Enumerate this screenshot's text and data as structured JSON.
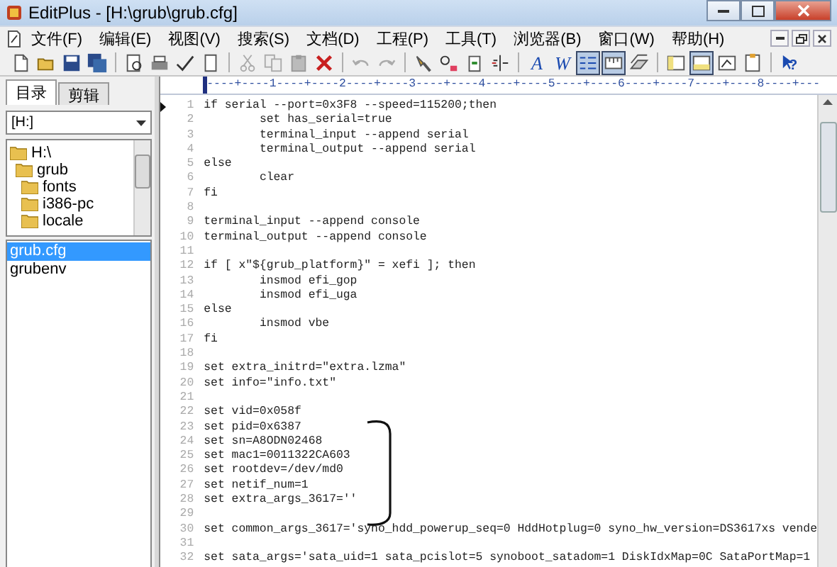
{
  "window": {
    "title": "EditPlus - [H:\\grub\\grub.cfg]"
  },
  "menu": [
    "文件(F)",
    "编辑(E)",
    "视图(V)",
    "搜索(S)",
    "文档(D)",
    "工程(P)",
    "工具(T)",
    "浏览器(B)",
    "窗口(W)",
    "帮助(H)"
  ],
  "toolbar": [
    {
      "kind": "new",
      "pressed": false
    },
    {
      "kind": "open",
      "pressed": false
    },
    {
      "kind": "save",
      "pressed": false
    },
    {
      "kind": "save-all",
      "pressed": false
    },
    {
      "kind": "separator"
    },
    {
      "kind": "preview",
      "pressed": false
    },
    {
      "kind": "print",
      "pressed": false
    },
    {
      "kind": "spell",
      "pressed": false
    },
    {
      "kind": "doc",
      "pressed": false
    },
    {
      "kind": "separator"
    },
    {
      "kind": "cut",
      "pressed": false
    },
    {
      "kind": "copy",
      "pressed": false
    },
    {
      "kind": "paste",
      "pressed": false
    },
    {
      "kind": "delete",
      "pressed": false
    },
    {
      "kind": "separator"
    },
    {
      "kind": "undo",
      "pressed": false
    },
    {
      "kind": "redo",
      "pressed": false
    },
    {
      "kind": "separator"
    },
    {
      "kind": "find",
      "pressed": false
    },
    {
      "kind": "replace",
      "pressed": false
    },
    {
      "kind": "goto",
      "pressed": false
    },
    {
      "kind": "column",
      "pressed": false
    },
    {
      "kind": "separator"
    },
    {
      "kind": "font",
      "glyph": "A",
      "pressed": false
    },
    {
      "kind": "wrap",
      "glyph": "W",
      "pressed": false
    },
    {
      "kind": "linenum",
      "pressed": true
    },
    {
      "kind": "ruler",
      "pressed": true
    },
    {
      "kind": "layers",
      "pressed": false
    },
    {
      "kind": "separator"
    },
    {
      "kind": "panel",
      "pressed": false
    },
    {
      "kind": "output",
      "pressed": true
    },
    {
      "kind": "browser",
      "pressed": false
    },
    {
      "kind": "clip",
      "pressed": false
    },
    {
      "kind": "separator"
    },
    {
      "kind": "help",
      "glyph": "?",
      "pressed": false
    }
  ],
  "sidebar": {
    "tabs": [
      {
        "label": "目录",
        "selected": true
      },
      {
        "label": "剪辑",
        "selected": false
      }
    ],
    "drive": "[H:]",
    "tree": [
      {
        "label": "H:\\",
        "children": [
          {
            "label": "grub",
            "children": [
              {
                "label": "fonts"
              },
              {
                "label": "i386-pc"
              },
              {
                "label": "locale"
              }
            ]
          }
        ]
      }
    ],
    "files": [
      {
        "label": "grub.cfg",
        "selected": true
      },
      {
        "label": "grubenv",
        "selected": false
      }
    ]
  },
  "editor": {
    "ruler": "----+----1----+----2----+----3----+----4----+----5----+----6----+----7----+----8----+---",
    "lines": [
      {
        "number": "1",
        "current": true,
        "text": "if serial --port=0x3F8 --speed=115200;then"
      },
      {
        "number": "2",
        "current": false,
        "text": "\tset has_serial=true"
      },
      {
        "number": "3",
        "current": false,
        "text": "\tterminal_input --append serial"
      },
      {
        "number": "4",
        "current": false,
        "text": "\tterminal_output --append serial"
      },
      {
        "number": "5",
        "current": false,
        "text": "else"
      },
      {
        "number": "6",
        "current": false,
        "text": "\tclear"
      },
      {
        "number": "7",
        "current": false,
        "text": "fi"
      },
      {
        "number": "8",
        "current": false
      },
      {
        "number": "9",
        "current": false,
        "text": "terminal_input --append console"
      },
      {
        "number": "10",
        "current": false,
        "text": "terminal_output --append console"
      },
      {
        "number": "11",
        "current": false
      },
      {
        "number": "12",
        "current": false,
        "text": "if [ x\"${grub_platform}\" = xefi ]; then"
      },
      {
        "number": "13",
        "current": false,
        "text": "\tinsmod efi_gop"
      },
      {
        "number": "14",
        "current": false,
        "text": "\tinsmod efi_uga"
      },
      {
        "number": "15",
        "current": false,
        "text": "else"
      },
      {
        "number": "16",
        "current": false,
        "text": "\tinsmod vbe"
      },
      {
        "number": "17",
        "current": false,
        "text": "fi"
      },
      {
        "number": "18",
        "current": false
      },
      {
        "number": "19",
        "current": false,
        "text": "set extra_initrd=\"extra.lzma\""
      },
      {
        "number": "20",
        "current": false,
        "text": "set info=\"info.txt\""
      },
      {
        "number": "21",
        "current": false
      },
      {
        "number": "22",
        "current": false,
        "text": "set vid=0x058f"
      },
      {
        "number": "23",
        "current": false,
        "text": "set pid=0x6387"
      },
      {
        "number": "24",
        "current": false,
        "text": "set sn=A8ODN02468"
      },
      {
        "number": "25",
        "current": false,
        "text": "set mac1=0011322CA603"
      },
      {
        "number": "26",
        "current": false,
        "text": "set rootdev=/dev/md0"
      },
      {
        "number": "27",
        "current": false,
        "text": "set netif_num=1"
      },
      {
        "number": "28",
        "current": false,
        "text": "set extra_args_3617=''"
      },
      {
        "number": "29",
        "current": false
      },
      {
        "number": "30",
        "current": false,
        "text": "set common_args_3617='syno_hdd_powerup_seq=0 HddHotplug=0 syno_hw_version=DS3617xs vende"
      },
      {
        "number": "31",
        "current": false
      },
      {
        "number": "32",
        "current": false,
        "text": "set sata_args='sata_uid=1 sata_pcislot=5 synoboot_satadom=1 DiskIdxMap=0C SataPortMap=1"
      }
    ]
  }
}
